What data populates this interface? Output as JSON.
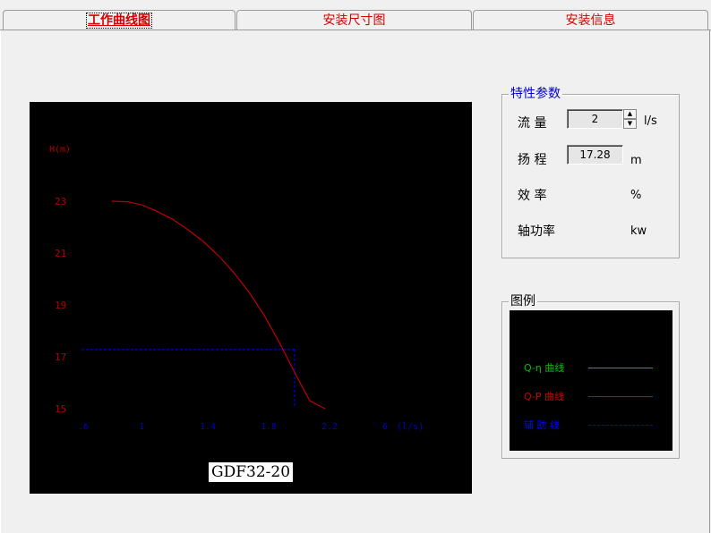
{
  "tabs": [
    {
      "label": "工作曲线图",
      "active": true
    },
    {
      "label": "安装尺寸图",
      "active": false
    },
    {
      "label": "安装信息",
      "active": false
    }
  ],
  "params": {
    "title": "特性参数",
    "flow": {
      "label": "流 量",
      "value": "2",
      "unit": "l/s"
    },
    "head": {
      "label": "扬 程",
      "value": "17.28",
      "unit": "m"
    },
    "efficiency": {
      "label": "效 率",
      "value": "",
      "unit": "%"
    },
    "power": {
      "label": "轴功率",
      "value": "",
      "unit": "kw"
    }
  },
  "legend": {
    "title": "图例",
    "items": [
      {
        "label": "Q-η 曲线",
        "color": "#00c000",
        "style": "solid"
      },
      {
        "label": "Q-P 曲线",
        "color": "#d00000",
        "style": "solid"
      },
      {
        "label": "辅 助 线",
        "color": "#0000ff",
        "style": "dashed"
      }
    ]
  },
  "chart_data": {
    "type": "line",
    "model": "GDF32-20",
    "ylabel": "H(m)",
    "xlabel": "(l/s)",
    "ylim": [
      15,
      23
    ],
    "xlim": [
      0.6,
      2.6
    ],
    "y_ticks": [
      "23",
      "21",
      "19",
      "17",
      "15"
    ],
    "x_ticks": [
      ".6",
      "1",
      "1.4",
      "1.8",
      "2.2",
      "6"
    ],
    "grid": false,
    "series": [
      {
        "color": "#c00000",
        "x": [
          0.8,
          0.9,
          1.0,
          1.1,
          1.2,
          1.3,
          1.4,
          1.5,
          1.6,
          1.7,
          1.8,
          1.9,
          2.0,
          2.1,
          2.2
        ],
        "y": [
          23.0,
          22.98,
          22.85,
          22.6,
          22.3,
          21.9,
          21.45,
          20.9,
          20.25,
          19.5,
          18.6,
          17.55,
          16.4,
          15.3,
          15.0
        ]
      }
    ],
    "auxiliary": {
      "x": 2.0,
      "y": 17.28,
      "color": "#0000ff"
    }
  }
}
